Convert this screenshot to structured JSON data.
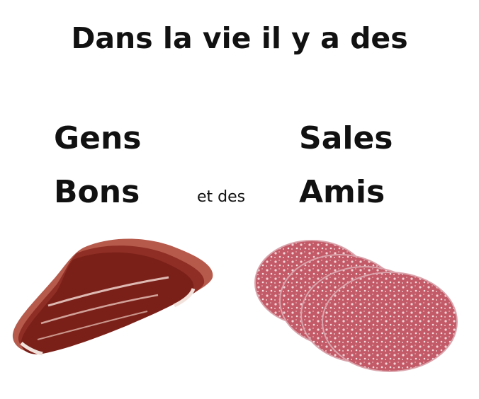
{
  "title": "Dans la vie il y a des",
  "left": {
    "line1": "Gens",
    "line2": "Bons"
  },
  "middle": "et des",
  "right": {
    "line1": "Sales",
    "line2": "Amis"
  },
  "images": {
    "left": "jambon-cru-slices",
    "right": "salami-slices"
  },
  "colors": {
    "ham": "#8a2a22",
    "salami": "#c9707a",
    "text": "#111111"
  }
}
